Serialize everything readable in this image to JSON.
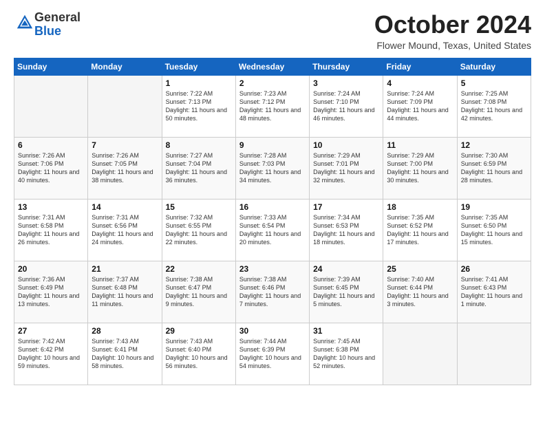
{
  "header": {
    "logo_general": "General",
    "logo_blue": "Blue",
    "month_title": "October 2024",
    "location": "Flower Mound, Texas, United States"
  },
  "weekdays": [
    "Sunday",
    "Monday",
    "Tuesday",
    "Wednesday",
    "Thursday",
    "Friday",
    "Saturday"
  ],
  "weeks": [
    [
      {
        "day": "",
        "sunrise": "",
        "sunset": "",
        "daylight": "",
        "empty": true
      },
      {
        "day": "",
        "sunrise": "",
        "sunset": "",
        "daylight": "",
        "empty": true
      },
      {
        "day": "1",
        "sunrise": "Sunrise: 7:22 AM",
        "sunset": "Sunset: 7:13 PM",
        "daylight": "Daylight: 11 hours and 50 minutes.",
        "empty": false
      },
      {
        "day": "2",
        "sunrise": "Sunrise: 7:23 AM",
        "sunset": "Sunset: 7:12 PM",
        "daylight": "Daylight: 11 hours and 48 minutes.",
        "empty": false
      },
      {
        "day": "3",
        "sunrise": "Sunrise: 7:24 AM",
        "sunset": "Sunset: 7:10 PM",
        "daylight": "Daylight: 11 hours and 46 minutes.",
        "empty": false
      },
      {
        "day": "4",
        "sunrise": "Sunrise: 7:24 AM",
        "sunset": "Sunset: 7:09 PM",
        "daylight": "Daylight: 11 hours and 44 minutes.",
        "empty": false
      },
      {
        "day": "5",
        "sunrise": "Sunrise: 7:25 AM",
        "sunset": "Sunset: 7:08 PM",
        "daylight": "Daylight: 11 hours and 42 minutes.",
        "empty": false
      }
    ],
    [
      {
        "day": "6",
        "sunrise": "Sunrise: 7:26 AM",
        "sunset": "Sunset: 7:06 PM",
        "daylight": "Daylight: 11 hours and 40 minutes.",
        "empty": false
      },
      {
        "day": "7",
        "sunrise": "Sunrise: 7:26 AM",
        "sunset": "Sunset: 7:05 PM",
        "daylight": "Daylight: 11 hours and 38 minutes.",
        "empty": false
      },
      {
        "day": "8",
        "sunrise": "Sunrise: 7:27 AM",
        "sunset": "Sunset: 7:04 PM",
        "daylight": "Daylight: 11 hours and 36 minutes.",
        "empty": false
      },
      {
        "day": "9",
        "sunrise": "Sunrise: 7:28 AM",
        "sunset": "Sunset: 7:03 PM",
        "daylight": "Daylight: 11 hours and 34 minutes.",
        "empty": false
      },
      {
        "day": "10",
        "sunrise": "Sunrise: 7:29 AM",
        "sunset": "Sunset: 7:01 PM",
        "daylight": "Daylight: 11 hours and 32 minutes.",
        "empty": false
      },
      {
        "day": "11",
        "sunrise": "Sunrise: 7:29 AM",
        "sunset": "Sunset: 7:00 PM",
        "daylight": "Daylight: 11 hours and 30 minutes.",
        "empty": false
      },
      {
        "day": "12",
        "sunrise": "Sunrise: 7:30 AM",
        "sunset": "Sunset: 6:59 PM",
        "daylight": "Daylight: 11 hours and 28 minutes.",
        "empty": false
      }
    ],
    [
      {
        "day": "13",
        "sunrise": "Sunrise: 7:31 AM",
        "sunset": "Sunset: 6:58 PM",
        "daylight": "Daylight: 11 hours and 26 minutes.",
        "empty": false
      },
      {
        "day": "14",
        "sunrise": "Sunrise: 7:31 AM",
        "sunset": "Sunset: 6:56 PM",
        "daylight": "Daylight: 11 hours and 24 minutes.",
        "empty": false
      },
      {
        "day": "15",
        "sunrise": "Sunrise: 7:32 AM",
        "sunset": "Sunset: 6:55 PM",
        "daylight": "Daylight: 11 hours and 22 minutes.",
        "empty": false
      },
      {
        "day": "16",
        "sunrise": "Sunrise: 7:33 AM",
        "sunset": "Sunset: 6:54 PM",
        "daylight": "Daylight: 11 hours and 20 minutes.",
        "empty": false
      },
      {
        "day": "17",
        "sunrise": "Sunrise: 7:34 AM",
        "sunset": "Sunset: 6:53 PM",
        "daylight": "Daylight: 11 hours and 18 minutes.",
        "empty": false
      },
      {
        "day": "18",
        "sunrise": "Sunrise: 7:35 AM",
        "sunset": "Sunset: 6:52 PM",
        "daylight": "Daylight: 11 hours and 17 minutes.",
        "empty": false
      },
      {
        "day": "19",
        "sunrise": "Sunrise: 7:35 AM",
        "sunset": "Sunset: 6:50 PM",
        "daylight": "Daylight: 11 hours and 15 minutes.",
        "empty": false
      }
    ],
    [
      {
        "day": "20",
        "sunrise": "Sunrise: 7:36 AM",
        "sunset": "Sunset: 6:49 PM",
        "daylight": "Daylight: 11 hours and 13 minutes.",
        "empty": false
      },
      {
        "day": "21",
        "sunrise": "Sunrise: 7:37 AM",
        "sunset": "Sunset: 6:48 PM",
        "daylight": "Daylight: 11 hours and 11 minutes.",
        "empty": false
      },
      {
        "day": "22",
        "sunrise": "Sunrise: 7:38 AM",
        "sunset": "Sunset: 6:47 PM",
        "daylight": "Daylight: 11 hours and 9 minutes.",
        "empty": false
      },
      {
        "day": "23",
        "sunrise": "Sunrise: 7:38 AM",
        "sunset": "Sunset: 6:46 PM",
        "daylight": "Daylight: 11 hours and 7 minutes.",
        "empty": false
      },
      {
        "day": "24",
        "sunrise": "Sunrise: 7:39 AM",
        "sunset": "Sunset: 6:45 PM",
        "daylight": "Daylight: 11 hours and 5 minutes.",
        "empty": false
      },
      {
        "day": "25",
        "sunrise": "Sunrise: 7:40 AM",
        "sunset": "Sunset: 6:44 PM",
        "daylight": "Daylight: 11 hours and 3 minutes.",
        "empty": false
      },
      {
        "day": "26",
        "sunrise": "Sunrise: 7:41 AM",
        "sunset": "Sunset: 6:43 PM",
        "daylight": "Daylight: 11 hours and 1 minute.",
        "empty": false
      }
    ],
    [
      {
        "day": "27",
        "sunrise": "Sunrise: 7:42 AM",
        "sunset": "Sunset: 6:42 PM",
        "daylight": "Daylight: 10 hours and 59 minutes.",
        "empty": false
      },
      {
        "day": "28",
        "sunrise": "Sunrise: 7:43 AM",
        "sunset": "Sunset: 6:41 PM",
        "daylight": "Daylight: 10 hours and 58 minutes.",
        "empty": false
      },
      {
        "day": "29",
        "sunrise": "Sunrise: 7:43 AM",
        "sunset": "Sunset: 6:40 PM",
        "daylight": "Daylight: 10 hours and 56 minutes.",
        "empty": false
      },
      {
        "day": "30",
        "sunrise": "Sunrise: 7:44 AM",
        "sunset": "Sunset: 6:39 PM",
        "daylight": "Daylight: 10 hours and 54 minutes.",
        "empty": false
      },
      {
        "day": "31",
        "sunrise": "Sunrise: 7:45 AM",
        "sunset": "Sunset: 6:38 PM",
        "daylight": "Daylight: 10 hours and 52 minutes.",
        "empty": false
      },
      {
        "day": "",
        "sunrise": "",
        "sunset": "",
        "daylight": "",
        "empty": true
      },
      {
        "day": "",
        "sunrise": "",
        "sunset": "",
        "daylight": "",
        "empty": true
      }
    ]
  ]
}
